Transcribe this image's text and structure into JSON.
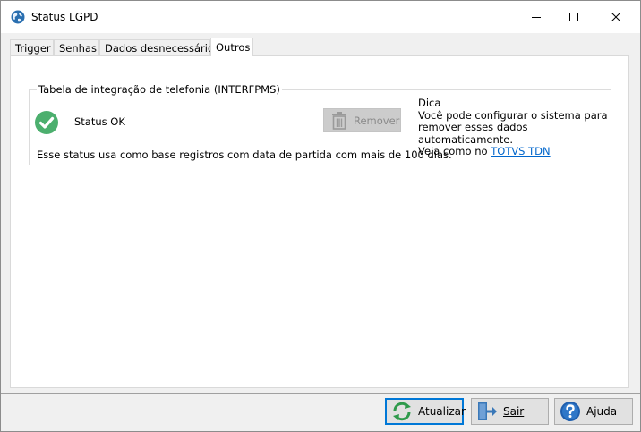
{
  "window": {
    "title": "Status LGPD",
    "icon": "globe-icon"
  },
  "tabs": [
    {
      "label": "Trigger",
      "active": false
    },
    {
      "label": "Senhas",
      "active": false
    },
    {
      "label": "Dados desnecessários",
      "active": false
    },
    {
      "label": "Outros",
      "active": true
    }
  ],
  "group": {
    "legend": "Tabela de integração de telefonia (INTERFPMS)",
    "status_label": "Status OK",
    "status_icon": "check-circle-icon",
    "status_color": "#4caf6e",
    "remove_label": "Remover",
    "remove_enabled": false,
    "description": "Esse status usa como base registros com data de partida com mais de 100 dias.",
    "tip": {
      "title": "Dica",
      "line1": "Você pode configurar o sistema para",
      "line2": "remover esses dados automaticamente.",
      "line3_prefix": "Veja como no ",
      "link": "TOTVS TDN"
    }
  },
  "footer": {
    "refresh_label": "Atualizar",
    "exit_label": "Sair",
    "help_label": "Ajuda"
  },
  "colors": {
    "accent": "#0078d7",
    "link": "#0066cc",
    "refresh_green": "#2e9a4b",
    "exit_blue": "#3a78b8",
    "help_blue": "#1f5fae"
  }
}
